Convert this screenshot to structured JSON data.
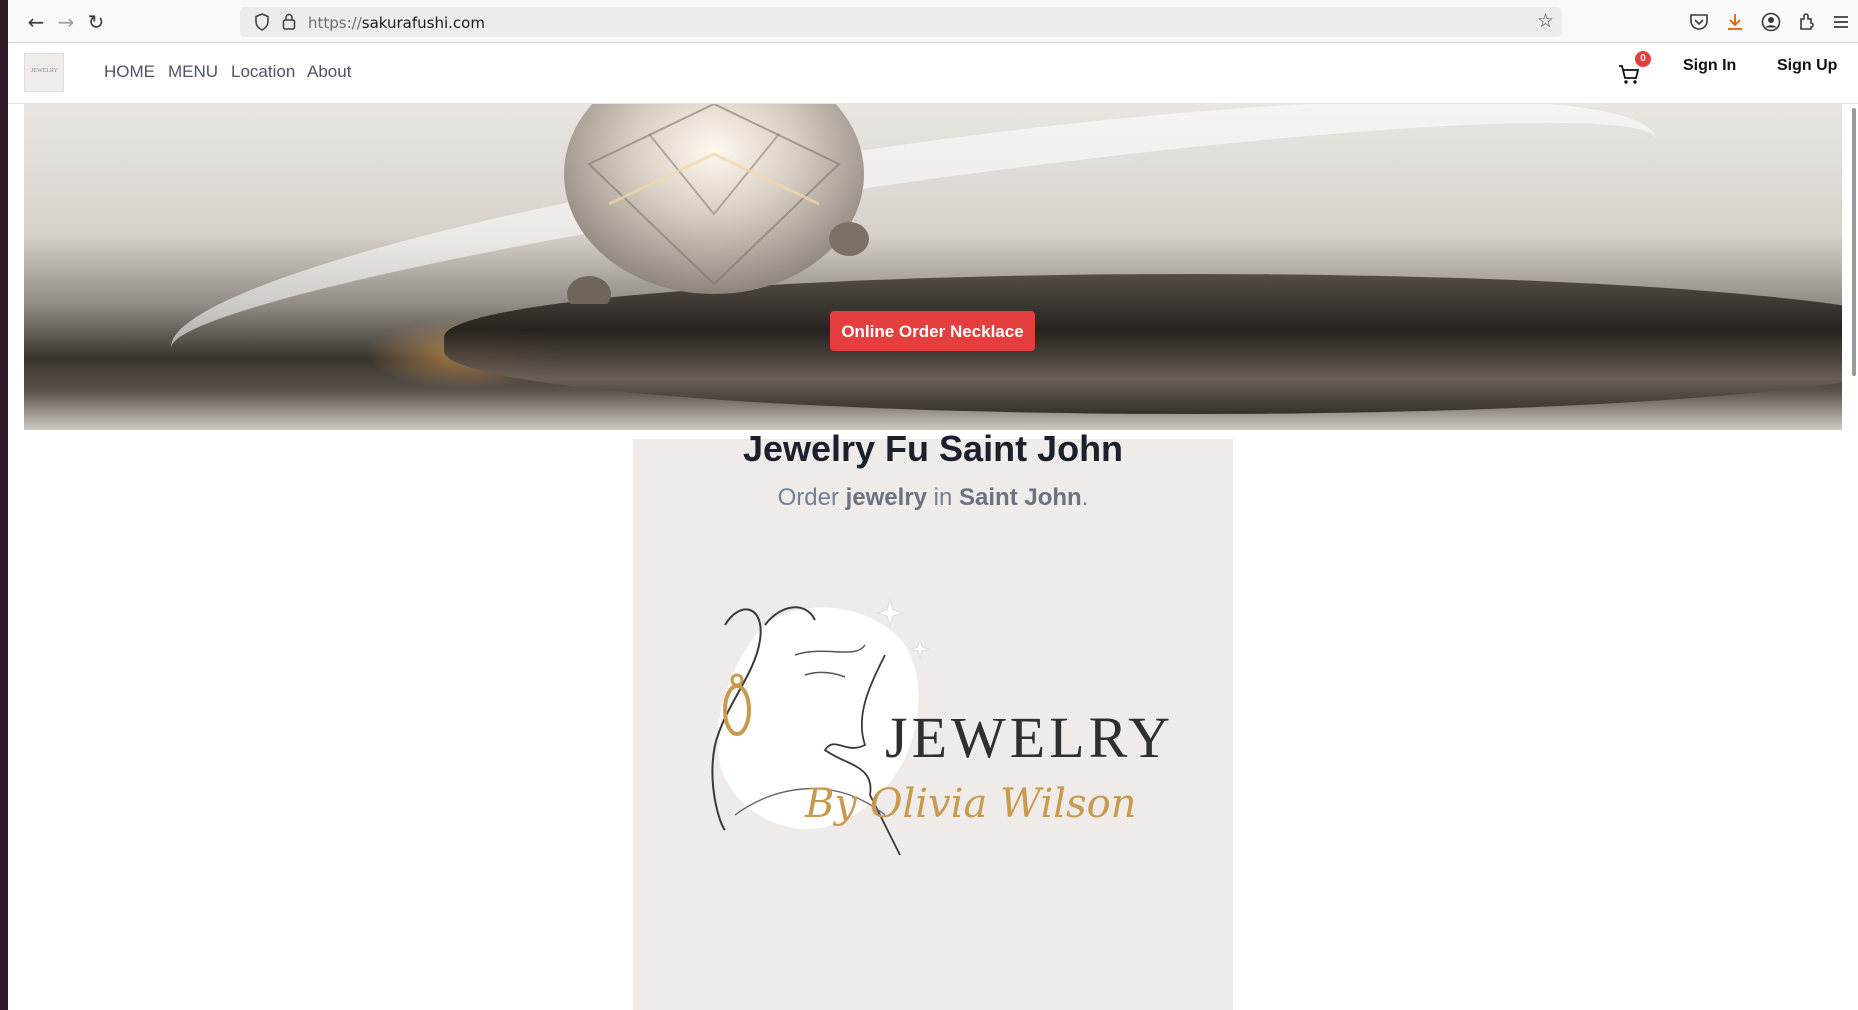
{
  "browser": {
    "url_protocol": "https://",
    "url_host": "sakurafushi.com",
    "icons": [
      "back-icon",
      "forward-icon",
      "reload-icon",
      "shield-icon",
      "lock-icon",
      "star-icon",
      "pocket-icon",
      "download-icon",
      "account-icon",
      "extensions-icon",
      "menu-icon"
    ]
  },
  "header": {
    "logo_text": "JEWELRY",
    "nav": [
      {
        "label": "HOME"
      },
      {
        "label": "MENU"
      },
      {
        "label": "Location"
      },
      {
        "label": "About"
      }
    ],
    "cart_count": "0",
    "sign_in": "Sign In",
    "sign_up": "Sign Up"
  },
  "hero": {
    "button_label": "Online Order Necklace"
  },
  "main": {
    "title": "Jewelry Fu Saint John",
    "subtitle_prefix": "Order ",
    "subtitle_item": "jewelry",
    "subtitle_mid": " in ",
    "subtitle_city": "Saint John",
    "subtitle_end": "."
  },
  "brand": {
    "word": "JEWELRY",
    "signature": "By Olivia Wilson",
    "accent_color": "#c99a4e"
  },
  "colors": {
    "primary_red": "#e53e3e",
    "heading": "#1a202c",
    "muted": "#718096"
  }
}
